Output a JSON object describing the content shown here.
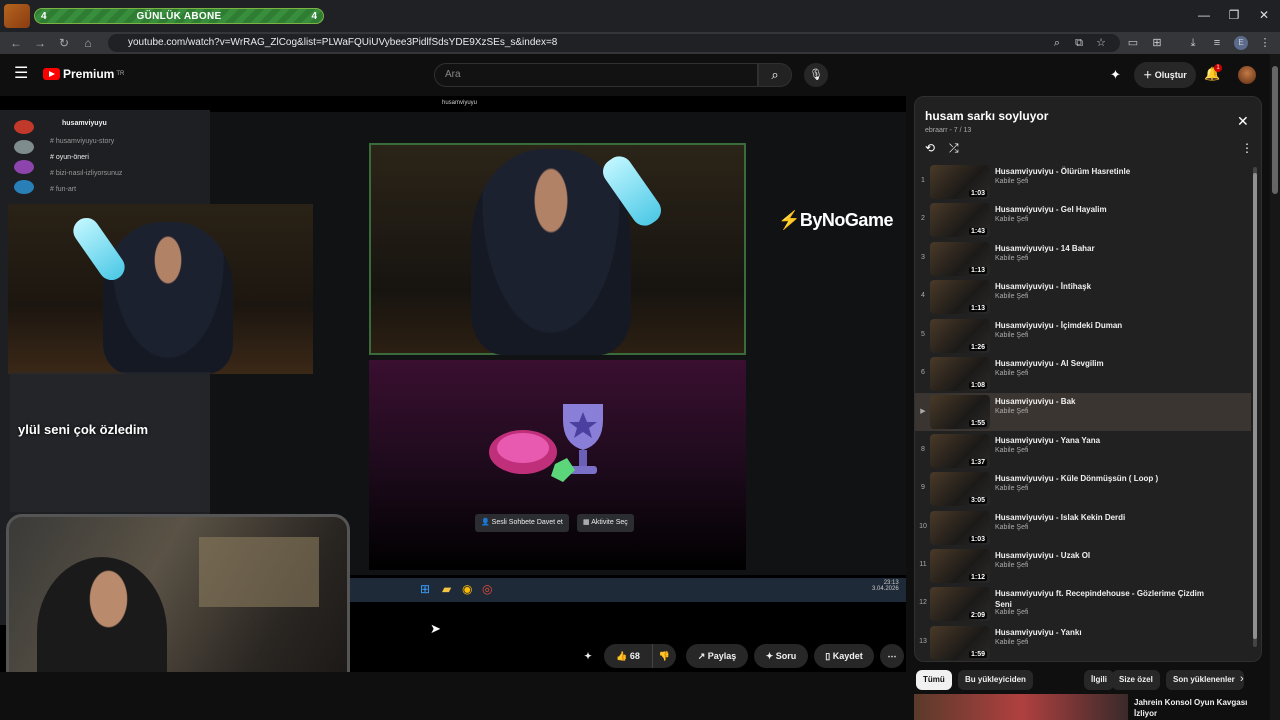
{
  "browser": {
    "sub_bar": {
      "left_count": "4",
      "title": "GÜNLÜK ABONE",
      "right_count": "4"
    },
    "url": "youtube.com/watch?v=WrRAG_ZlCog&list=PLWaFQUiUVybee3PidlfSdsYDE9XzSEs_s&index=8",
    "window_controls": {
      "minimize": "—",
      "restore": "❐",
      "close": "✕"
    }
  },
  "header": {
    "brand": "Premium",
    "brand_region": "TR",
    "search_placeholder": "Ara",
    "create_label": "Oluştur",
    "notification_count": "1"
  },
  "video": {
    "discord": {
      "server_name": "husamviyuyu",
      "top_label": "husamviyuyu",
      "channels": [
        "husamviyuyu-story",
        "oyun-öneri",
        "bizi-nasıl-izliyorsunuz",
        "fun-art"
      ],
      "activity_invite": "Sesli Sohbete Davet et",
      "activity_select": "Aktivite Seç",
      "taskbar_time": "23:13",
      "taskbar_date": "3.04.2026"
    },
    "overlay_text": "ylül seni çok özledim",
    "sponsor": "ByNoGame"
  },
  "actions": {
    "like_count": "68",
    "share_label": "Paylaş",
    "ask_label": "Soru",
    "save_label": "Kaydet"
  },
  "playlist": {
    "title": "husam sarkı soyluyor",
    "subtitle": "ebraarr - 7 / 13",
    "items": [
      {
        "index": "1",
        "title": "Husamviyuviyu - Ölürüm Hasretinle",
        "channel": "Kabile Şefi",
        "duration": "1:03",
        "active": false
      },
      {
        "index": "2",
        "title": "Husamviyuviyu - Gel Hayalim",
        "channel": "Kabile Şefi",
        "duration": "1:43",
        "active": false
      },
      {
        "index": "3",
        "title": "Husamviyuviyu - 14 Bahar",
        "channel": "Kabile Şefi",
        "duration": "1:13",
        "active": false
      },
      {
        "index": "4",
        "title": "Husamviyuviyu - İntihaşk",
        "channel": "Kabile Şefi",
        "duration": "1:13",
        "active": false
      },
      {
        "index": "5",
        "title": "Husamviyuviyu - İçimdeki Duman",
        "channel": "Kabile Şefi",
        "duration": "1:26",
        "active": false
      },
      {
        "index": "6",
        "title": "Husamviyuviyu - Al Sevgilim",
        "channel": "Kabile Şefi",
        "duration": "1:08",
        "active": false
      },
      {
        "index": "▶",
        "title": "Husamviyuviyu - Bak",
        "channel": "Kabile Şefi",
        "duration": "1:55",
        "active": true
      },
      {
        "index": "8",
        "title": "Husamviyuviyu - Yana Yana",
        "channel": "Kabile Şefi",
        "duration": "1:37",
        "active": false
      },
      {
        "index": "9",
        "title": "Husamviyuviyu - Küle Dönmüşsün ( Loop )",
        "channel": "Kabile Şefi",
        "duration": "3:05",
        "active": false
      },
      {
        "index": "10",
        "title": "Husamviyuviyu - Islak Kekin Derdi",
        "channel": "Kabile Şefi",
        "duration": "1:03",
        "active": false
      },
      {
        "index": "11",
        "title": "Husamviyuviyu - Uzak Ol",
        "channel": "Kabile Şefi",
        "duration": "1:12",
        "active": false
      },
      {
        "index": "12",
        "title": "Husamviyuviyu ft. Recepindehouse - Gözlerime Çizdim Seni",
        "channel": "Kabile Şefi",
        "duration": "2:09",
        "active": false
      },
      {
        "index": "13",
        "title": "Husamviyuviyu - Yankı",
        "channel": "Kabile Şefi",
        "duration": "1:59",
        "active": false
      }
    ]
  },
  "chips": [
    "Tümü",
    "Bu yükleyiciden",
    "İlgili",
    "Size özel",
    "Son yüklenenler"
  ],
  "recommendation": {
    "title": "Jahrein Konsol Oyun Kavgası İzliyor"
  }
}
